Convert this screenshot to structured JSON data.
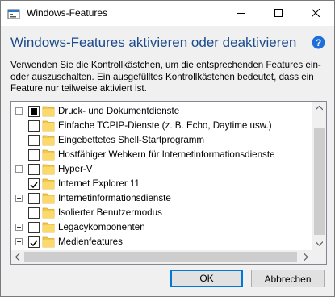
{
  "window": {
    "title": "Windows-Features",
    "minimize_icon": "minimize-icon",
    "maximize_icon": "maximize-icon",
    "close_icon": "close-icon"
  },
  "header": {
    "heading": "Windows-Features aktivieren oder deaktivieren",
    "help_icon": "help-icon"
  },
  "description": {
    "line1": "Verwenden Sie die Kontrollkästchen, um die entsprechenden Features ein-",
    "line2": "oder auszuschalten. Ein ausgefülltes Kontrollkästchen bedeutet, dass ein",
    "line3": "Feature nur teilweise aktiviert ist."
  },
  "features": [
    {
      "label": "Druck- und Dokumentdienste",
      "expandable": true,
      "state": "partial"
    },
    {
      "label": "Einfache TCPIP-Dienste (z. B. Echo, Daytime usw.)",
      "expandable": false,
      "state": "unchecked"
    },
    {
      "label": "Eingebettetes Shell-Startprogramm",
      "expandable": false,
      "state": "unchecked"
    },
    {
      "label": "Hostfähiger Webkern für Internetinformationsdienste",
      "expandable": false,
      "state": "unchecked"
    },
    {
      "label": "Hyper-V",
      "expandable": true,
      "state": "unchecked"
    },
    {
      "label": "Internet Explorer 11",
      "expandable": false,
      "state": "checked"
    },
    {
      "label": "Internetinformationsdienste",
      "expandable": true,
      "state": "unchecked"
    },
    {
      "label": "Isolierter Benutzermodus",
      "expandable": false,
      "state": "unchecked"
    },
    {
      "label": "Legacykomponenten",
      "expandable": true,
      "state": "unchecked"
    },
    {
      "label": "Medienfeatures",
      "expandable": true,
      "state": "checked"
    }
  ],
  "buttons": {
    "ok_label": "OK",
    "cancel_label": "Abbrechen"
  },
  "colors": {
    "heading": "#1a4b8c",
    "folder": "#f3c94d",
    "accent": "#0078d7"
  }
}
